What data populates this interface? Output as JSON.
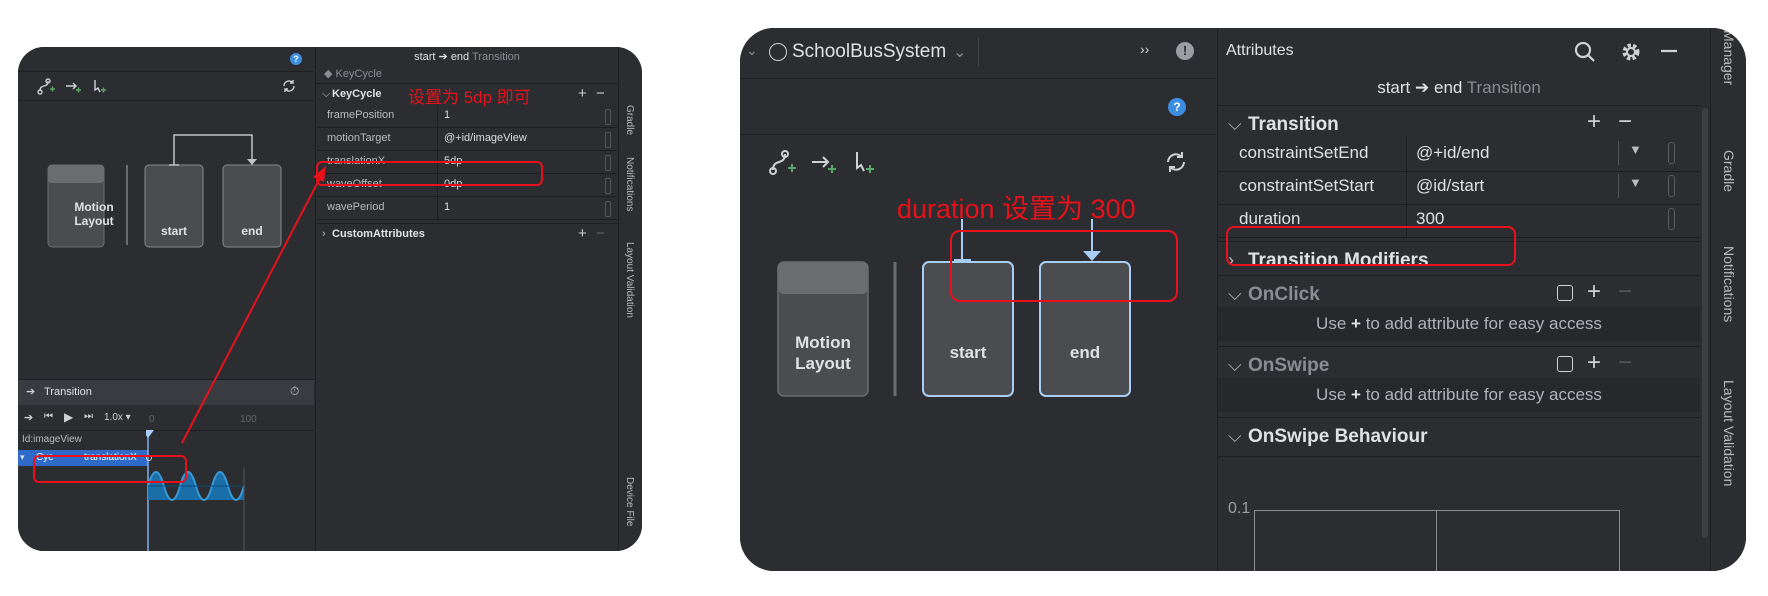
{
  "left_panel": {
    "toolbar_icons": [
      "create-constraintset-icon",
      "create-transition-icon",
      "create-onclick-icon",
      "cycle-icon"
    ],
    "help_icon": "?",
    "nodes": {
      "motion_layout": "Motion Layout",
      "start": "start",
      "end": "end"
    },
    "attributes": {
      "breadcrumb": {
        "from": "start",
        "arrow": "➔",
        "to": "end",
        "kind": "Transition"
      },
      "subtitle": "KeyCycle",
      "section": "KeyCycle",
      "annotation": "设置为 5dp 即可",
      "rows": [
        {
          "key": "framePosition",
          "value": "1"
        },
        {
          "key": "motionTarget",
          "value": "@+id/imageView"
        },
        {
          "key": "translationX",
          "value": "5dp"
        },
        {
          "key": "waveOffset",
          "value": "0dp"
        },
        {
          "key": "wavePeriod",
          "value": "1"
        }
      ],
      "custom_section": "CustomAttributes"
    },
    "timeline": {
      "title": "Transition",
      "speed": "1.0x",
      "tick_start": "0",
      "tick_end": "100",
      "target": "Id:imageView",
      "track_type": "Cyc",
      "track_attr": "translationX"
    },
    "side_tabs": [
      "Gradle",
      "Notifications",
      "Layout Validation",
      "Device File"
    ]
  },
  "right_panel": {
    "app_title": "SchoolBusSystem",
    "more_glyph": "››",
    "attributes_title": "Attributes",
    "help_icon": "?",
    "breadcrumb": {
      "from": "start",
      "arrow": "➔",
      "to": "end",
      "kind": "Transition"
    },
    "nodes": {
      "motion_layout_line1": "Motion",
      "motion_layout_line2": "Layout",
      "start": "start",
      "end": "end"
    },
    "annotation": "duration 设置为 300",
    "sections": {
      "transition": "Transition",
      "modifiers": "Transition Modifiers",
      "onclick": "OnClick",
      "onswipe": "OnSwipe",
      "onswipe_behaviour": "OnSwipe Behaviour"
    },
    "rows": [
      {
        "key": "constraintSetEnd",
        "value": "@+id/end"
      },
      {
        "key": "constraintSetStart",
        "value": "@id/start"
      },
      {
        "key": "duration",
        "value": "300"
      }
    ],
    "hints": {
      "prefix": "Use",
      "plus": "+",
      "suffix": "to add attribute for easy access"
    },
    "graph_tick": "0.1",
    "side_tabs": [
      "Manager",
      "Gradle",
      "Notifications",
      "Layout Validation"
    ]
  },
  "colors": {
    "annotation_red": "#e8111b",
    "selected_blue": "#7fb2e8",
    "panel_bg": "#2b2d30"
  }
}
